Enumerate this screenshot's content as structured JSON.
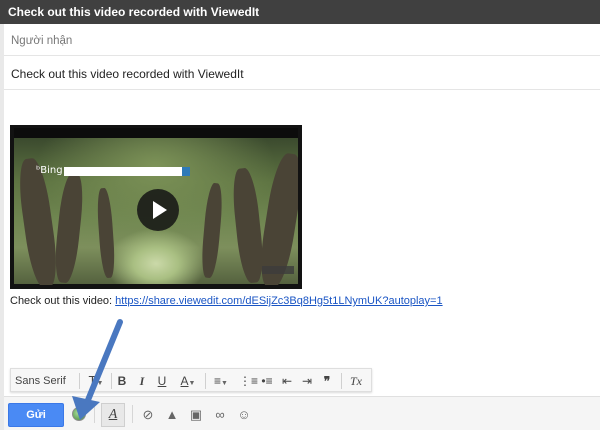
{
  "window": {
    "title": "Check out this video recorded with ViewedIt"
  },
  "recipients": {
    "placeholder": "Người nhận"
  },
  "subject": {
    "value": "Check out this video recorded with ViewedIt"
  },
  "video": {
    "search_logo": "Bing"
  },
  "body": {
    "video_text": "Check out this video: ",
    "video_link": "https://share.viewedit.com/dESijZc3Bq8Hg5t1LNymUK?autoplay=1"
  },
  "format_toolbar": {
    "font": "Sans Serif",
    "size": "T",
    "bold": "B",
    "italic": "I",
    "underline": "U",
    "text_color": "A",
    "remove_format": "Tx"
  },
  "bottom_bar": {
    "send_label": "Gửi",
    "formatting_toggle": "A"
  },
  "colors": {
    "accent": "#4a8af4",
    "link": "#1a55c4",
    "titlebar": "#404040",
    "arrow": "#4a78c0"
  }
}
